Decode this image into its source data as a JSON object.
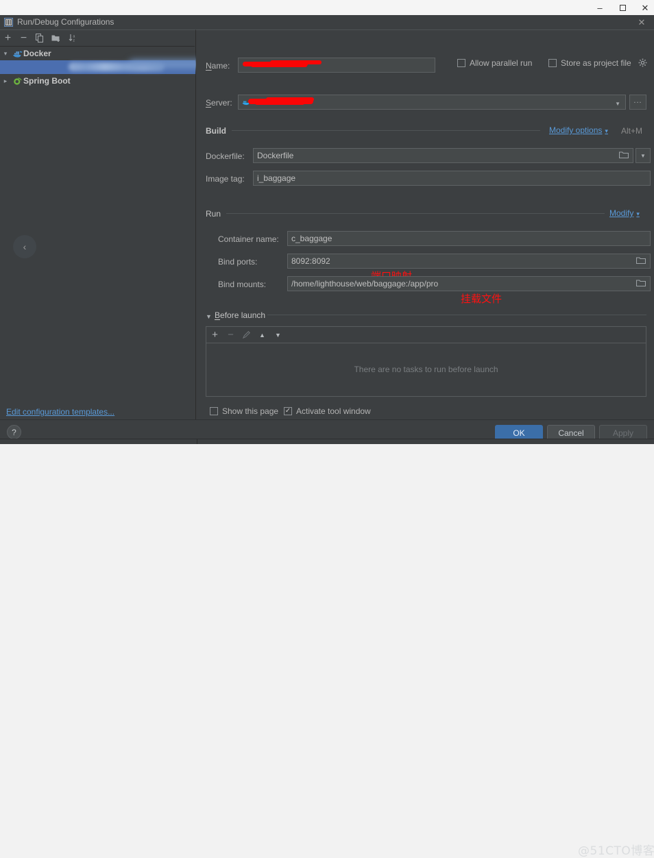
{
  "os_window": {
    "minimize_label": "–",
    "maximize_label": "",
    "close_label": "✕"
  },
  "dialog": {
    "title": "Run/Debug Configurations",
    "close_label": "✕",
    "icon": "idea-run-config-icon"
  },
  "left_panel": {
    "toolbar": [
      {
        "name": "add-configuration",
        "glyph": "+"
      },
      {
        "name": "remove-configuration",
        "glyph": "−"
      },
      {
        "name": "copy-configuration",
        "glyph": "copy-icon"
      },
      {
        "name": "new-folder",
        "glyph": "folder-add-icon"
      },
      {
        "name": "sort-configurations",
        "glyph": "sort-az-icon"
      }
    ],
    "tree": [
      {
        "label": "Docker",
        "icon": "docker-icon",
        "arrow": "⌄",
        "expanded": true,
        "selected": false
      },
      {
        "label": "",
        "icon": "",
        "arrow": "",
        "expanded": false,
        "selected": true,
        "redacted": true
      },
      {
        "label": "Spring Boot",
        "icon": "spring-boot-icon",
        "arrow": "›",
        "expanded": false,
        "selected": false
      }
    ],
    "collapse_handle": "‹",
    "edit_templates_link": "Edit configuration templates..."
  },
  "form": {
    "name": {
      "label": "Name:",
      "mnemonic": "N",
      "value": "",
      "redacted": true
    },
    "allow_parallel_run": {
      "label": "Allow parallel run",
      "mnemonic": "u",
      "checked": false
    },
    "store_as_project_file": {
      "label": "Store as project file",
      "mnemonic": "S",
      "checked": false
    },
    "store_gear_icon": "gear-icon",
    "server": {
      "label": "Server:",
      "mnemonic": "S",
      "value": "",
      "redacted": true
    },
    "server_browse_label": "...",
    "build_section": {
      "title": "Build",
      "modify_options_link": "Modify options",
      "modify_options_chevron": "⌄",
      "modify_options_shortcut": "Alt+M",
      "dockerfile": {
        "label": "Dockerfile:",
        "value": "Dockerfile"
      },
      "image_tag": {
        "label": "Image tag:",
        "value": "i_baggage"
      }
    },
    "run_section": {
      "title": "Run",
      "modify_link": "Modify",
      "modify_chevron": "⌄",
      "container_name": {
        "label": "Container name:",
        "value": "c_baggage"
      },
      "bind_ports": {
        "label": "Bind ports:",
        "value": "8092:8092"
      },
      "bind_mounts": {
        "label": "Bind mounts:",
        "value": "/home/lighthouse/web/baggage:/app/pro"
      }
    },
    "annotations": [
      {
        "text": "端口映射",
        "color": "#ff1111"
      },
      {
        "text": "挂载文件",
        "color": "#ff1111"
      }
    ],
    "before_launch": {
      "title": "Before launch",
      "mnemonic": "B",
      "collapse_arrow": "▼",
      "toolbar": [
        {
          "name": "add-task",
          "glyph": "+",
          "enabled": true
        },
        {
          "name": "remove-task",
          "glyph": "−",
          "enabled": false
        },
        {
          "name": "edit-task",
          "glyph": "pencil-icon",
          "enabled": false
        },
        {
          "name": "move-up",
          "glyph": "▲",
          "enabled": true
        },
        {
          "name": "move-down",
          "glyph": "▼",
          "enabled": true
        }
      ],
      "empty_text": "There are no tasks to run before launch"
    },
    "show_this_page": {
      "label": "Show this page",
      "checked": false
    },
    "activate_tool_window": {
      "label": "Activate tool window",
      "checked": true,
      "check_glyph": "✓"
    }
  },
  "buttons": {
    "help": "?",
    "ok": "OK",
    "cancel": "Cancel",
    "apply": "Apply"
  },
  "watermark": "@51CTO博客",
  "colors": {
    "background": "#3c3f41",
    "field": "#45494a",
    "selection": "#4b6eaf",
    "link": "#5a9ad8",
    "ok_button": "#3b6ea8",
    "annotation": "#ff1111",
    "titlebar": "#f5f5f5"
  }
}
